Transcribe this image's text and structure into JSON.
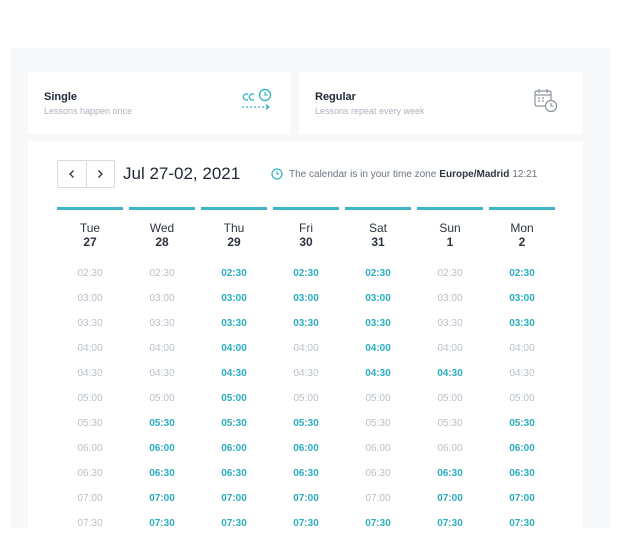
{
  "lesson_types": [
    {
      "title": "Single",
      "subtitle": "Lessons happen once",
      "icon": "single-lesson-icon"
    },
    {
      "title": "Regular",
      "subtitle": "Lessons repeat every week",
      "icon": "calendar-clock-icon"
    }
  ],
  "calendar": {
    "range": "Jul 27-02, 2021",
    "tz_prefix": "The calendar is in your time zone",
    "tz_name": "Europe/Madrid",
    "tz_time": "12:21"
  },
  "accent_color": "#3cb6c4",
  "days": [
    {
      "day": "Tue",
      "date": "27",
      "slots": [
        {
          "time": "02:30",
          "available": false
        },
        {
          "time": "03:00",
          "available": false
        },
        {
          "time": "03:30",
          "available": false
        },
        {
          "time": "04:00",
          "available": false
        },
        {
          "time": "04:30",
          "available": false
        },
        {
          "time": "05:00",
          "available": false
        },
        {
          "time": "05:30",
          "available": false
        },
        {
          "time": "06:00",
          "available": false
        },
        {
          "time": "06:30",
          "available": false
        },
        {
          "time": "07:00",
          "available": false
        },
        {
          "time": "07:30",
          "available": false
        }
      ]
    },
    {
      "day": "Wed",
      "date": "28",
      "slots": [
        {
          "time": "02:30",
          "available": false
        },
        {
          "time": "03:00",
          "available": false
        },
        {
          "time": "03:30",
          "available": false
        },
        {
          "time": "04:00",
          "available": false
        },
        {
          "time": "04:30",
          "available": false
        },
        {
          "time": "05:00",
          "available": false
        },
        {
          "time": "05:30",
          "available": true
        },
        {
          "time": "06:00",
          "available": true
        },
        {
          "time": "06:30",
          "available": true
        },
        {
          "time": "07:00",
          "available": true
        },
        {
          "time": "07:30",
          "available": true
        }
      ]
    },
    {
      "day": "Thu",
      "date": "29",
      "slots": [
        {
          "time": "02:30",
          "available": true
        },
        {
          "time": "03:00",
          "available": true
        },
        {
          "time": "03:30",
          "available": true
        },
        {
          "time": "04:00",
          "available": true
        },
        {
          "time": "04:30",
          "available": true
        },
        {
          "time": "05:00",
          "available": true
        },
        {
          "time": "05:30",
          "available": true
        },
        {
          "time": "06:00",
          "available": true
        },
        {
          "time": "06:30",
          "available": true
        },
        {
          "time": "07:00",
          "available": true
        },
        {
          "time": "07:30",
          "available": true
        }
      ]
    },
    {
      "day": "Fri",
      "date": "30",
      "slots": [
        {
          "time": "02:30",
          "available": true
        },
        {
          "time": "03:00",
          "available": true
        },
        {
          "time": "03:30",
          "available": true
        },
        {
          "time": "04:00",
          "available": false
        },
        {
          "time": "04:30",
          "available": false
        },
        {
          "time": "05:00",
          "available": false
        },
        {
          "time": "05:30",
          "available": true
        },
        {
          "time": "06:00",
          "available": true
        },
        {
          "time": "06:30",
          "available": true
        },
        {
          "time": "07:00",
          "available": true
        },
        {
          "time": "07:30",
          "available": true
        }
      ]
    },
    {
      "day": "Sat",
      "date": "31",
      "slots": [
        {
          "time": "02:30",
          "available": true
        },
        {
          "time": "03:00",
          "available": true
        },
        {
          "time": "03:30",
          "available": true
        },
        {
          "time": "04:00",
          "available": true
        },
        {
          "time": "04:30",
          "available": true
        },
        {
          "time": "05:00",
          "available": false
        },
        {
          "time": "05:30",
          "available": false
        },
        {
          "time": "06:00",
          "available": false
        },
        {
          "time": "06:30",
          "available": false
        },
        {
          "time": "07:00",
          "available": false
        },
        {
          "time": "07:30",
          "available": true
        }
      ]
    },
    {
      "day": "Sun",
      "date": "1",
      "slots": [
        {
          "time": "02:30",
          "available": false
        },
        {
          "time": "03:00",
          "available": false
        },
        {
          "time": "03:30",
          "available": false
        },
        {
          "time": "04:00",
          "available": false
        },
        {
          "time": "04:30",
          "available": true
        },
        {
          "time": "05:00",
          "available": false
        },
        {
          "time": "05:30",
          "available": false
        },
        {
          "time": "06:00",
          "available": false
        },
        {
          "time": "06:30",
          "available": true
        },
        {
          "time": "07:00",
          "available": true
        },
        {
          "time": "07:30",
          "available": true
        }
      ]
    },
    {
      "day": "Mon",
      "date": "2",
      "slots": [
        {
          "time": "02:30",
          "available": true
        },
        {
          "time": "03:00",
          "available": true
        },
        {
          "time": "03:30",
          "available": true
        },
        {
          "time": "04:00",
          "available": false
        },
        {
          "time": "04:30",
          "available": false
        },
        {
          "time": "05:00",
          "available": false
        },
        {
          "time": "05:30",
          "available": true
        },
        {
          "time": "06:00",
          "available": true
        },
        {
          "time": "06:30",
          "available": true
        },
        {
          "time": "07:00",
          "available": true
        },
        {
          "time": "07:30",
          "available": true
        }
      ]
    }
  ]
}
